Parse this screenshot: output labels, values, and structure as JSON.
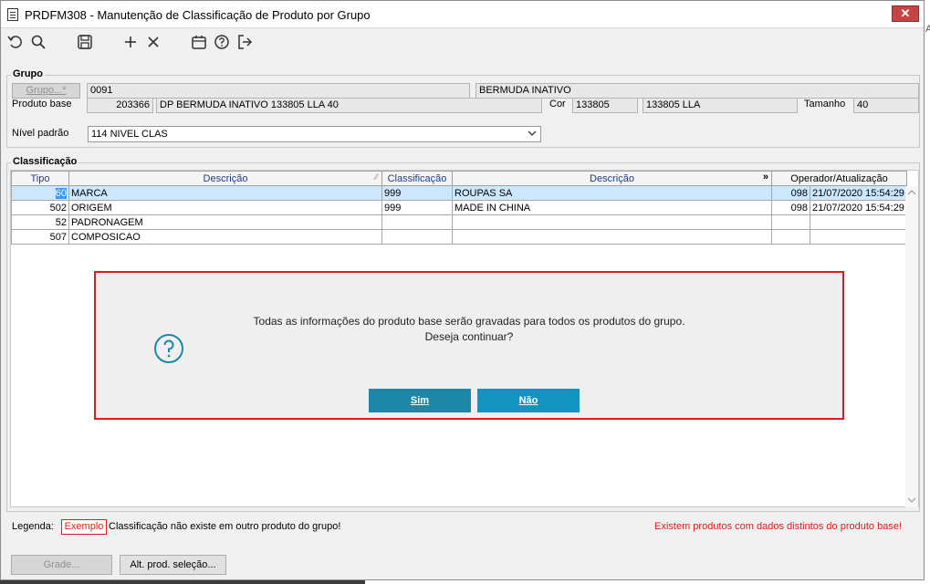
{
  "window": {
    "title": "PRDFM308 - Manutenção de Classificação de Produto por Grupo",
    "close_label": "✕"
  },
  "toolbar": {
    "icons": [
      "undo-icon",
      "search-icon",
      "save-icon",
      "add-icon",
      "delete-icon",
      "calendar-icon",
      "help-icon",
      "exit-icon"
    ]
  },
  "grupo": {
    "section_title": "Grupo",
    "grupo_button": "Grupo...*",
    "grupo_code": "0091",
    "grupo_desc": "BERMUDA INATIVO",
    "produto_base_label": "Produto base",
    "produto_base_code": "203366",
    "produto_base_desc": "DP BERMUDA INATIVO 133805 LLA 40",
    "cor_label": "Cor",
    "cor_code": "133805",
    "cor_desc": "133805 LLA",
    "tamanho_label": "Tamanho",
    "tamanho_value": "40",
    "nivel_label": "Nível padrão",
    "nivel_value": "114 NIVEL CLAS"
  },
  "classificacao": {
    "section_title": "Classificação",
    "columns": [
      "Tipo",
      "Descrição",
      "Classificação",
      "Descrição",
      "Operador/Atualização"
    ],
    "rows": [
      {
        "tipo": "60",
        "descricao": "MARCA",
        "classificacao": "999",
        "class_desc": "ROUPAS SA",
        "operador": "098",
        "atualizacao": "21/07/2020 15:54:29"
      },
      {
        "tipo": "502",
        "descricao": "ORIGEM",
        "classificacao": "999",
        "class_desc": "MADE IN CHINA",
        "operador": "098",
        "atualizacao": "21/07/2020 15:54:29"
      },
      {
        "tipo": "52",
        "descricao": "PADRONAGEM",
        "classificacao": "",
        "class_desc": "",
        "operador": "",
        "atualizacao": ""
      },
      {
        "tipo": "507",
        "descricao": "COMPOSICAO",
        "classificacao": "",
        "class_desc": "",
        "operador": "",
        "atualizacao": ""
      }
    ]
  },
  "dialog": {
    "line1": "Todas as informações do produto base serão gravadas para todos os produtos do grupo.",
    "line2": "Deseja continuar?",
    "yes_label": "Sim",
    "no_label": "Não",
    "icon": "question-icon"
  },
  "legend": {
    "label": "Legenda:",
    "sample": "Exemplo",
    "sample_text": "Classificação não existe em outro produto do grupo!",
    "warning": "Existem produtos com dados distintos do produto base!"
  },
  "footer": {
    "grade_label": "Grade...",
    "alt_label": "Alt. prod. seleção..."
  },
  "colors": {
    "accent_blue": "#1e87a8",
    "warning_red": "#e01b1b",
    "selection": "#cce8ff"
  }
}
